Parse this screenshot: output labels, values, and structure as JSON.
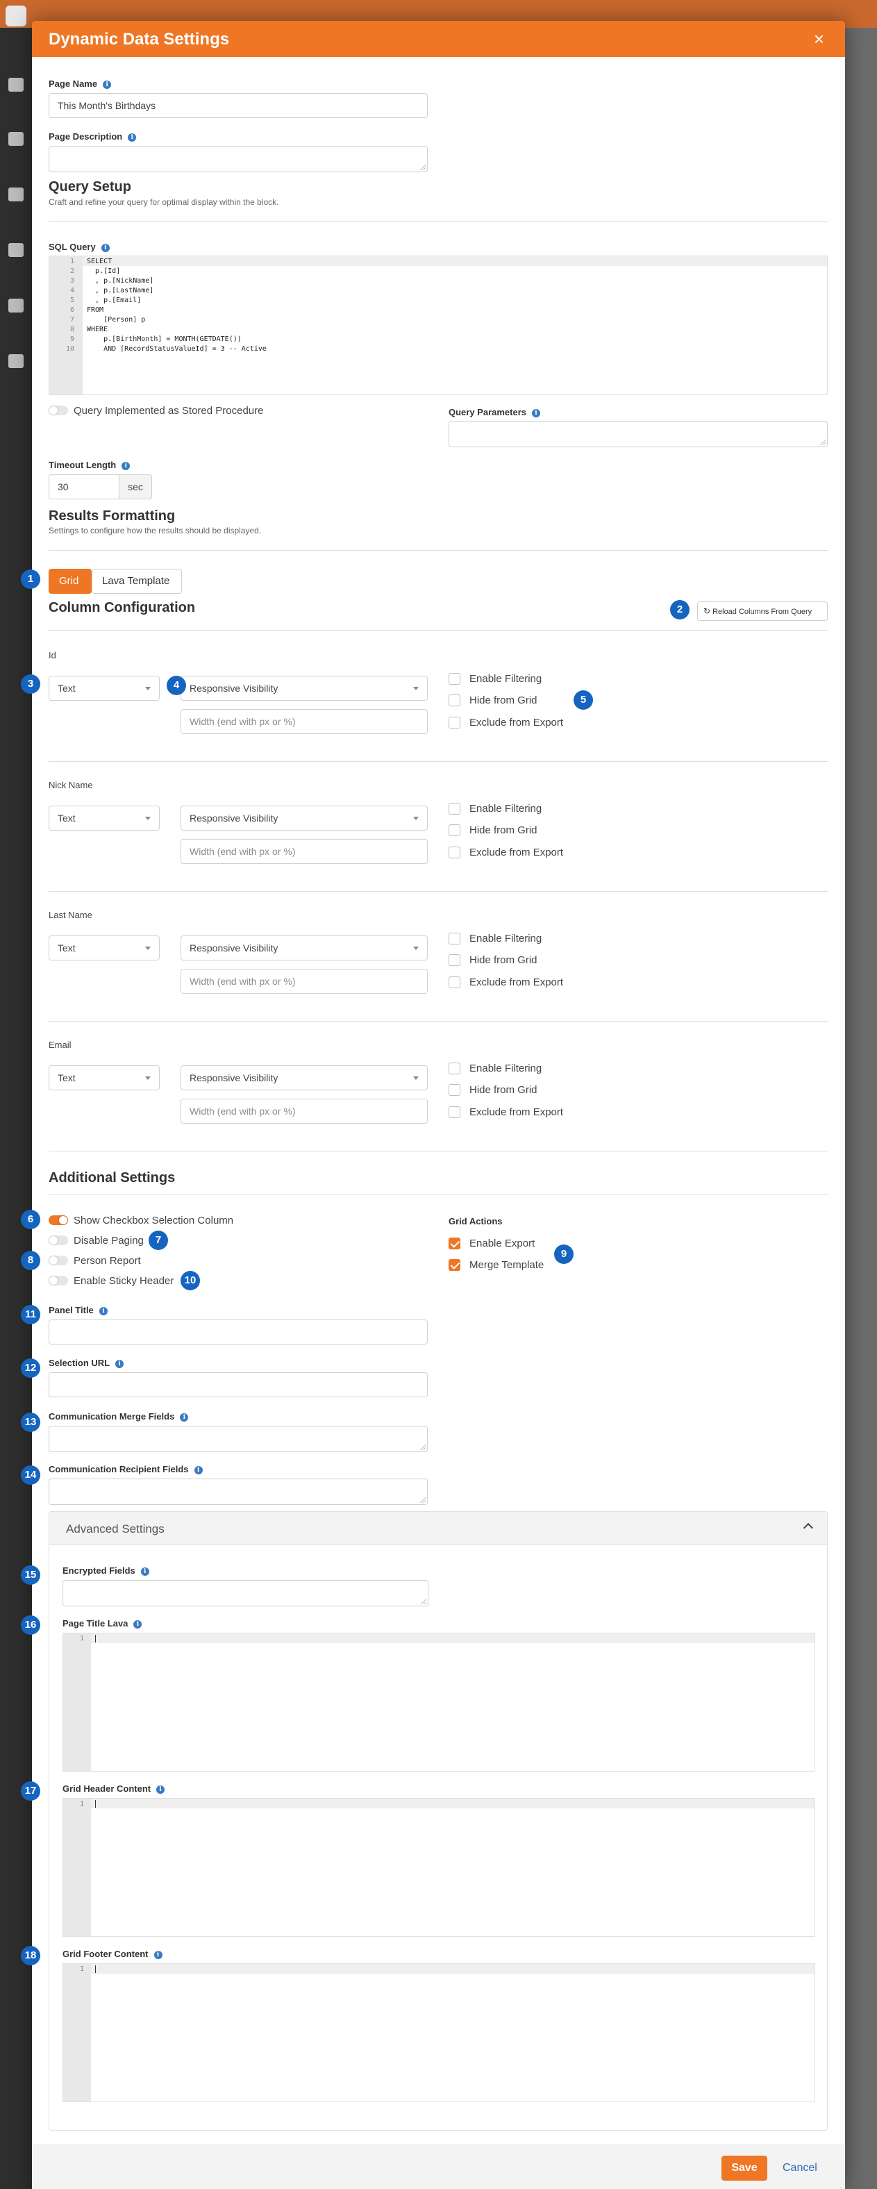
{
  "modal": {
    "title": "Dynamic Data Settings",
    "close_glyph": "×"
  },
  "page_name": {
    "label": "Page Name",
    "value": "This Month's Birthdays"
  },
  "page_description": {
    "label": "Page Description",
    "value": ""
  },
  "query_setup": {
    "title": "Query Setup",
    "subtitle": "Craft and refine your query for optimal display within the block.",
    "sql_label": "SQL Query",
    "sql_lines": [
      "SELECT",
      "  p.[Id]",
      "  , p.[NickName]",
      "  , p.[LastName]",
      "  , p.[Email]",
      "FROM",
      "    [Person] p",
      "WHERE",
      "    p.[BirthMonth] = MONTH(GETDATE())",
      "    AND [RecordStatusValueId] = 3 -- Active"
    ],
    "line_numbers": [
      "1",
      "2",
      "3",
      "4",
      "5",
      "6",
      "7",
      "8",
      "9",
      "10"
    ],
    "stored_procedure_label": "Query Implemented as Stored Procedure",
    "query_parameters_label": "Query Parameters",
    "timeout_label": "Timeout Length",
    "timeout_value": "30",
    "timeout_unit": "sec"
  },
  "results_formatting": {
    "title": "Results Formatting",
    "subtitle": "Settings to configure how the results should be displayed.",
    "tab_grid": "Grid",
    "tab_lava": "Lava Template"
  },
  "column_config": {
    "title": "Column Configuration",
    "reload_label": "Reload Columns From Query",
    "columns": [
      {
        "name": "Id",
        "type": "Text",
        "visibility": "Responsive Visibility",
        "width_placeholder": "Width (end with px or %)",
        "enable_filtering": "Enable Filtering",
        "hide_from_grid": "Hide from Grid",
        "exclude_from_export": "Exclude from Export"
      },
      {
        "name": "Nick Name",
        "type": "Text",
        "visibility": "Responsive Visibility",
        "width_placeholder": "Width (end with px or %)",
        "enable_filtering": "Enable Filtering",
        "hide_from_grid": "Hide from Grid",
        "exclude_from_export": "Exclude from Export"
      },
      {
        "name": "Last Name",
        "type": "Text",
        "visibility": "Responsive Visibility",
        "width_placeholder": "Width (end with px or %)",
        "enable_filtering": "Enable Filtering",
        "hide_from_grid": "Hide from Grid",
        "exclude_from_export": "Exclude from Export"
      },
      {
        "name": "Email",
        "type": "Text",
        "visibility": "Responsive Visibility",
        "width_placeholder": "Width (end with px or %)",
        "enable_filtering": "Enable Filtering",
        "hide_from_grid": "Hide from Grid",
        "exclude_from_export": "Exclude from Export"
      }
    ]
  },
  "additional_settings": {
    "title": "Additional Settings",
    "show_checkbox": "Show Checkbox Selection Column",
    "disable_paging": "Disable Paging",
    "person_report": "Person Report",
    "sticky_header": "Enable Sticky Header",
    "grid_actions_label": "Grid Actions",
    "enable_export": "Enable Export",
    "merge_template": "Merge Template",
    "panel_title_label": "Panel Title",
    "selection_url_label": "Selection URL",
    "comm_merge_label": "Communication Merge Fields",
    "comm_recipient_label": "Communication Recipient Fields"
  },
  "advanced_settings": {
    "title": "Advanced Settings",
    "encrypted_label": "Encrypted Fields",
    "page_title_lava_label": "Page Title Lava",
    "grid_header_label": "Grid Header Content",
    "grid_footer_label": "Grid Footer Content",
    "line_one": "1"
  },
  "badges": [
    "1",
    "2",
    "3",
    "4",
    "5",
    "6",
    "7",
    "8",
    "9",
    "10",
    "11",
    "12",
    "13",
    "14",
    "15",
    "16",
    "17",
    "18"
  ],
  "footer": {
    "save": "Save",
    "cancel": "Cancel"
  },
  "colors": {
    "accent": "#ee7624",
    "badge": "#1565c0",
    "link": "#2b6cb5"
  }
}
